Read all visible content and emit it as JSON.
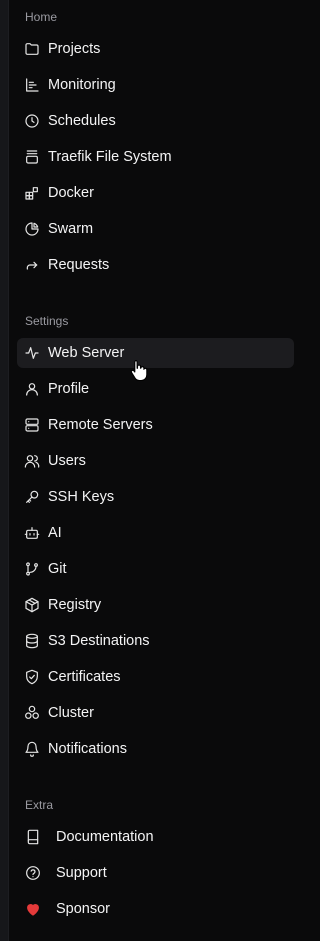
{
  "sections": {
    "home": {
      "label": "Home",
      "items": [
        {
          "label": "Projects",
          "icon": "folder-icon"
        },
        {
          "label": "Monitoring",
          "icon": "bar-chart-icon"
        },
        {
          "label": "Schedules",
          "icon": "clock-icon"
        },
        {
          "label": "Traefik File System",
          "icon": "stack-icon"
        },
        {
          "label": "Docker",
          "icon": "blocks-icon"
        },
        {
          "label": "Swarm",
          "icon": "pie-chart-icon"
        },
        {
          "label": "Requests",
          "icon": "forward-arrow-icon"
        }
      ]
    },
    "settings": {
      "label": "Settings",
      "items": [
        {
          "label": "Web Server",
          "icon": "activity-icon",
          "active": true
        },
        {
          "label": "Profile",
          "icon": "user-icon"
        },
        {
          "label": "Remote Servers",
          "icon": "server-icon"
        },
        {
          "label": "Users",
          "icon": "users-icon"
        },
        {
          "label": "SSH Keys",
          "icon": "key-icon"
        },
        {
          "label": "AI",
          "icon": "bot-icon"
        },
        {
          "label": "Git",
          "icon": "git-branch-icon"
        },
        {
          "label": "Registry",
          "icon": "package-icon"
        },
        {
          "label": "S3 Destinations",
          "icon": "database-icon"
        },
        {
          "label": "Certificates",
          "icon": "shield-check-icon"
        },
        {
          "label": "Cluster",
          "icon": "cluster-icon"
        },
        {
          "label": "Notifications",
          "icon": "bell-icon"
        }
      ]
    },
    "extra": {
      "label": "Extra",
      "items": [
        {
          "label": "Documentation",
          "icon": "book-icon"
        },
        {
          "label": "Support",
          "icon": "help-circle-icon"
        },
        {
          "label": "Sponsor",
          "icon": "heart-icon"
        }
      ]
    }
  },
  "colors": {
    "background": "#0a0a0b",
    "active_item": "#1c1c1f",
    "section_label": "#9a9aa1",
    "heart": "#e53a3a"
  }
}
